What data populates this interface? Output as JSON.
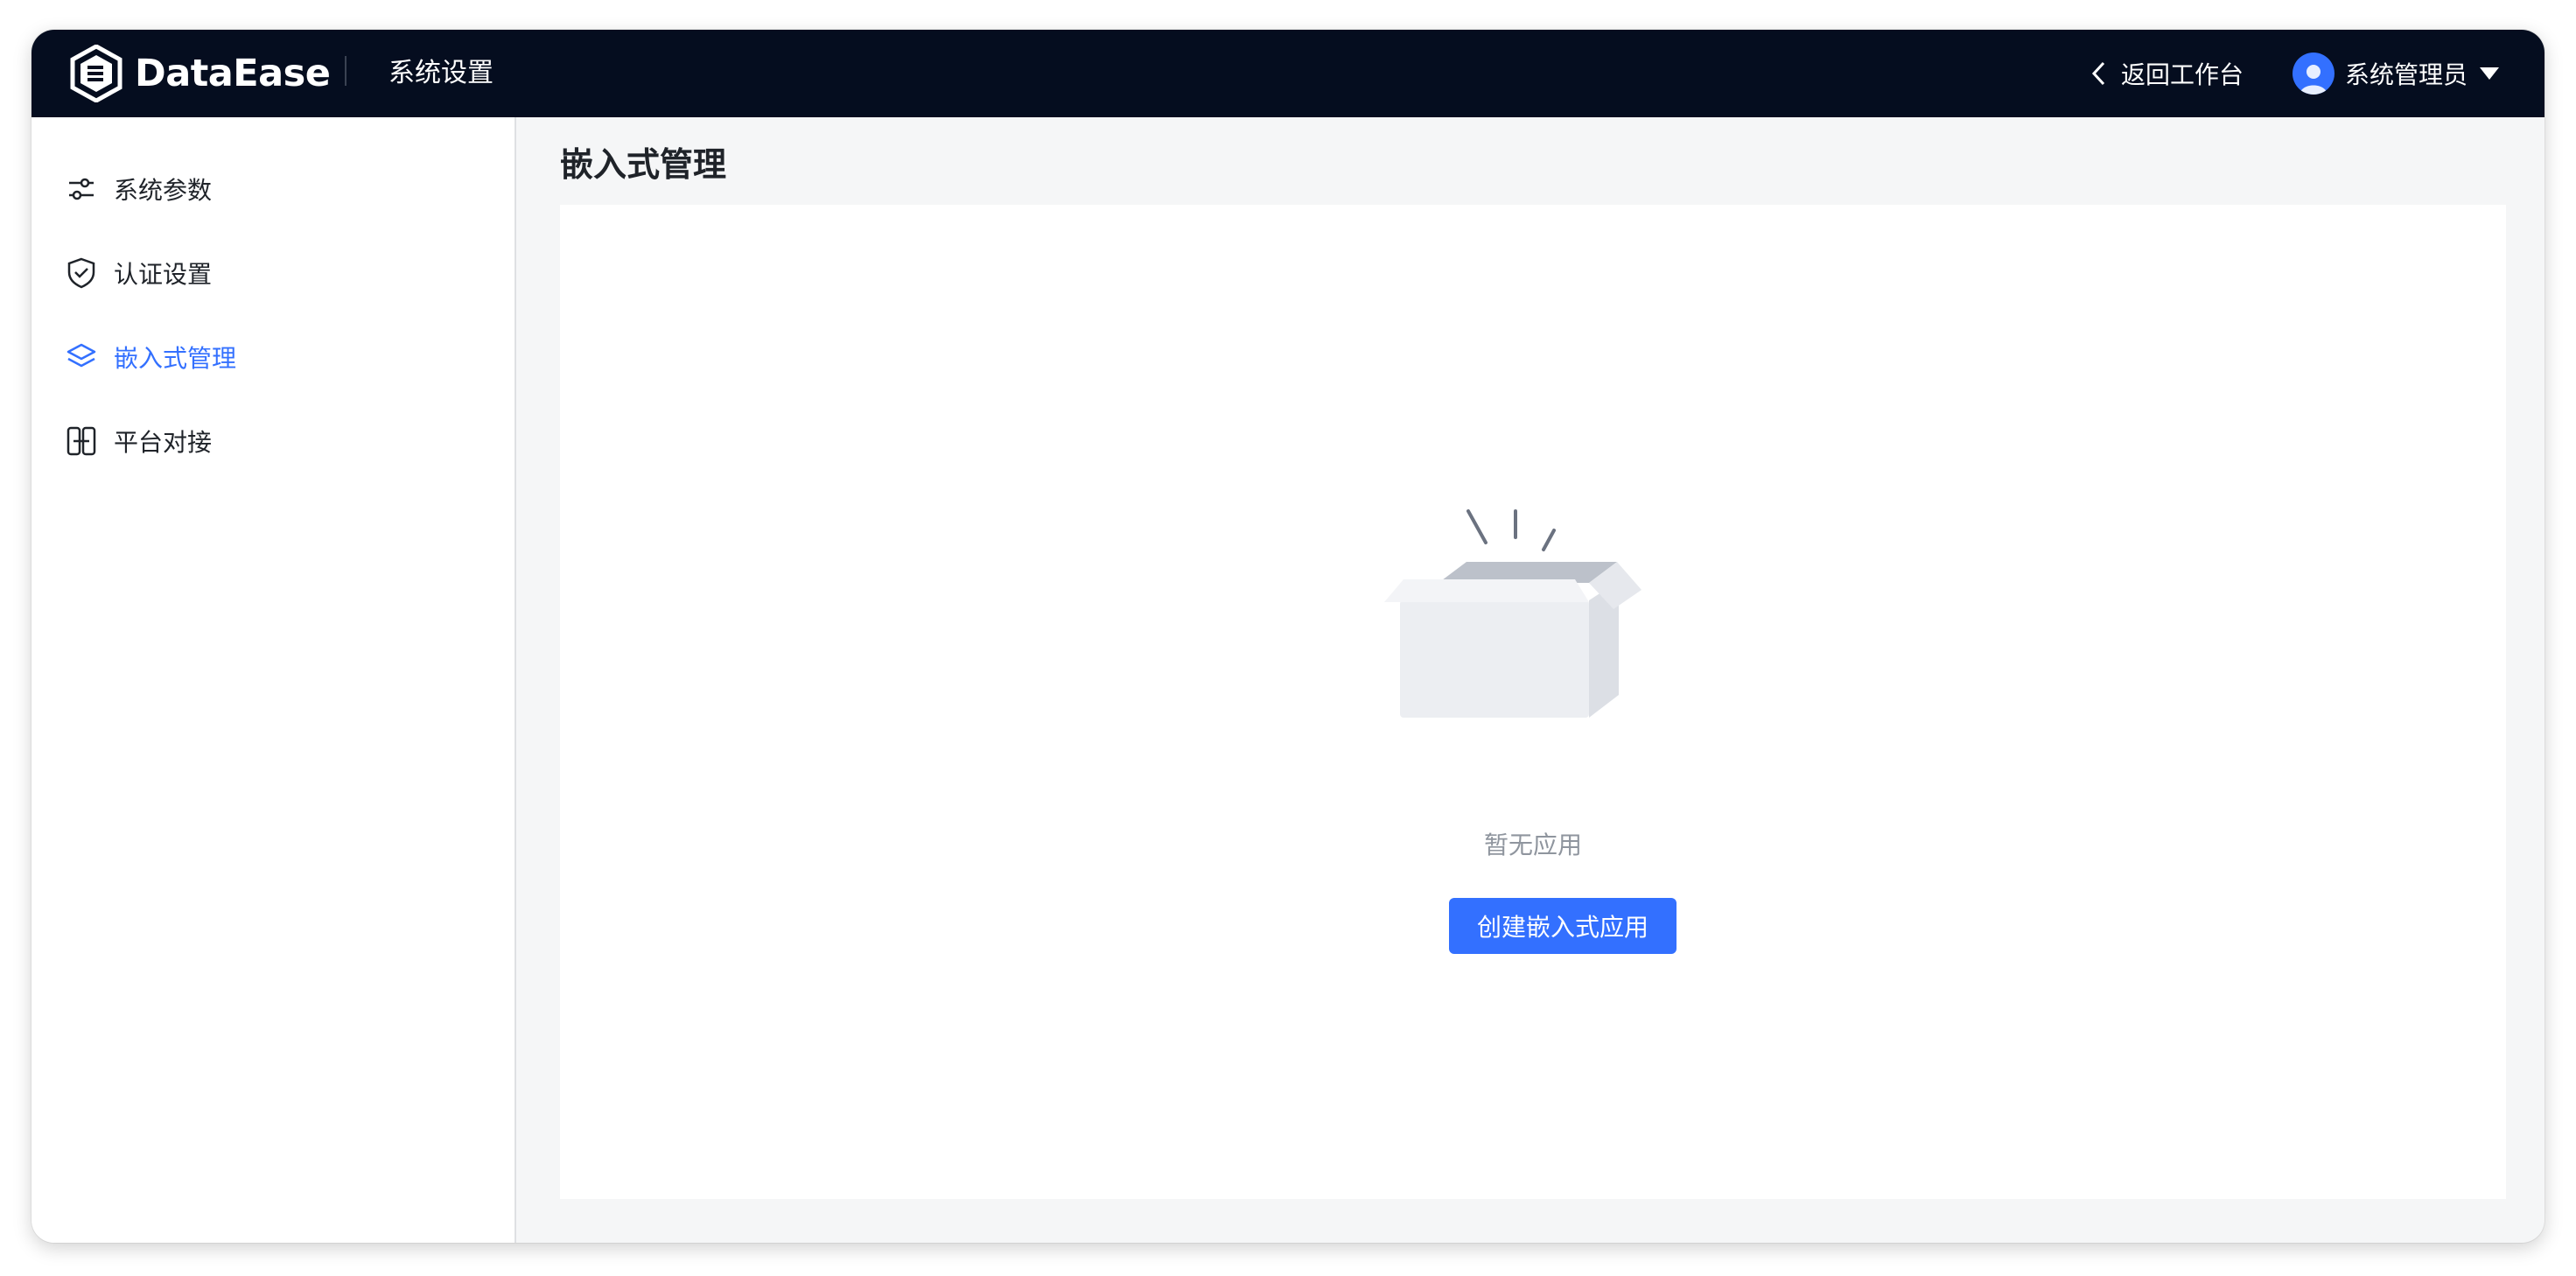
{
  "header": {
    "brand": "DataEase",
    "app_title": "系统设置",
    "back_label": "返回工作台",
    "user_name": "系统管理员"
  },
  "sidebar": {
    "items": [
      {
        "label": "系统参数",
        "icon": "sliders-icon",
        "active": false
      },
      {
        "label": "认证设置",
        "icon": "shield-check-icon",
        "active": false
      },
      {
        "label": "嵌入式管理",
        "icon": "layers-icon",
        "active": true
      },
      {
        "label": "平台对接",
        "icon": "link-icon",
        "active": false
      }
    ]
  },
  "main": {
    "title": "嵌入式管理",
    "empty_text": "暂无应用",
    "create_button": "创建嵌入式应用"
  },
  "colors": {
    "topbar": "#050d1f",
    "accent": "#3370ff",
    "text": "#1f2329",
    "muted": "#8f959e"
  }
}
